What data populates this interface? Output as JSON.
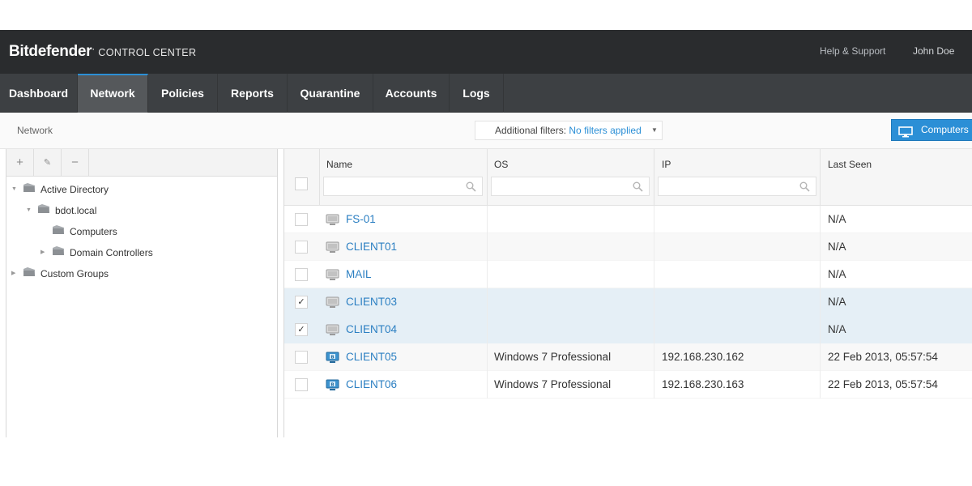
{
  "header": {
    "brand_name": "Bitdefender",
    "brand_mark": "·",
    "brand_sub": "CONTROL CENTER",
    "help_link": "Help & Support",
    "user_name": "John Doe"
  },
  "nav": {
    "tabs": [
      {
        "label": "Dashboard"
      },
      {
        "label": "Network",
        "active": true
      },
      {
        "label": "Policies"
      },
      {
        "label": "Reports"
      },
      {
        "label": "Quarantine"
      },
      {
        "label": "Accounts"
      },
      {
        "label": "Logs"
      }
    ]
  },
  "subheader": {
    "page_title": "Network",
    "filters_label": "Additional filters:",
    "filters_value": "No filters applied",
    "view_button": "Computers"
  },
  "tree": {
    "toolbar": {
      "add": "+",
      "edit": "✎",
      "remove": "−"
    },
    "items": [
      {
        "label": "Active Directory",
        "expanded": true
      },
      {
        "label": "bdot.local",
        "expanded": true
      },
      {
        "label": "Computers"
      },
      {
        "label": "Domain Controllers",
        "expanded": false
      },
      {
        "label": "Custom Groups",
        "expanded": false
      }
    ]
  },
  "grid": {
    "columns": [
      {
        "label": "Name"
      },
      {
        "label": "OS"
      },
      {
        "label": "IP"
      },
      {
        "label": "Last Seen"
      }
    ],
    "rows": [
      {
        "name": "FS-01",
        "os": "",
        "ip": "",
        "last_seen": "N/A",
        "checked": false,
        "managed": false
      },
      {
        "name": "CLIENT01",
        "os": "",
        "ip": "",
        "last_seen": "N/A",
        "checked": false,
        "managed": false
      },
      {
        "name": "MAIL",
        "os": "",
        "ip": "",
        "last_seen": "N/A",
        "checked": false,
        "managed": false
      },
      {
        "name": "CLIENT03",
        "os": "",
        "ip": "",
        "last_seen": "N/A",
        "checked": true,
        "managed": false
      },
      {
        "name": "CLIENT04",
        "os": "",
        "ip": "",
        "last_seen": "N/A",
        "checked": true,
        "managed": false
      },
      {
        "name": "CLIENT05",
        "os": "Windows 7 Professional",
        "ip": "192.168.230.162",
        "last_seen": "22 Feb 2013, 05:57:54",
        "checked": false,
        "managed": true
      },
      {
        "name": "CLIENT06",
        "os": "Windows 7 Professional",
        "ip": "192.168.230.163",
        "last_seen": "22 Feb 2013, 05:57:54",
        "checked": false,
        "managed": true
      }
    ]
  },
  "colors": {
    "header_bg": "#2a2c2e",
    "nav_bg": "#3d4043",
    "accent": "#2b8fd6",
    "link": "#2b7fc2",
    "selected_row": "#e5eff6"
  }
}
